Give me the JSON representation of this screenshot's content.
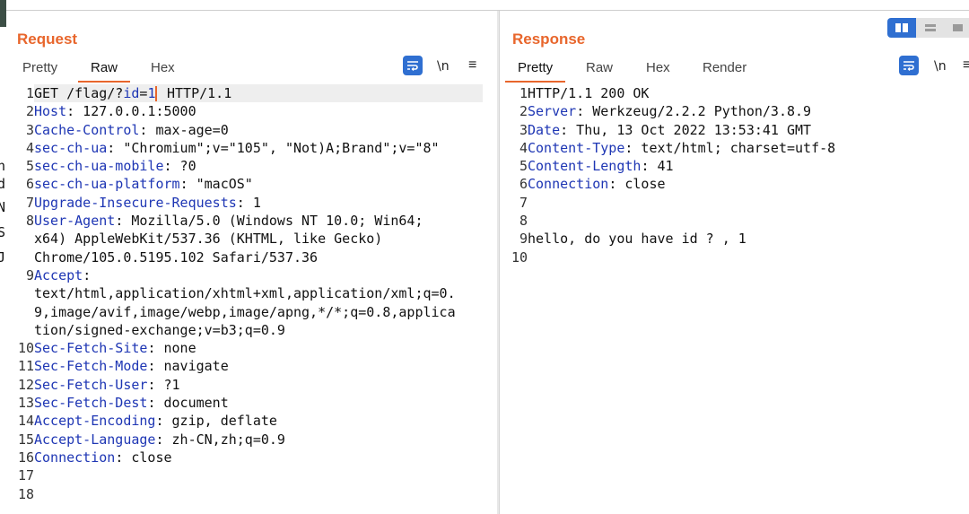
{
  "edge_letters": [
    "h",
    "d",
    "N",
    "S",
    "J"
  ],
  "request": {
    "title": "Request",
    "tabs": [
      "Pretty",
      "Raw",
      "Hex"
    ],
    "active_tab": "Raw",
    "tool_newline": "\\n",
    "tool_menu": "≡",
    "lines": [
      {
        "n": "1",
        "parts": [
          {
            "t": "GET /flag/?",
            "c": "v"
          },
          {
            "t": "id",
            "c": "k"
          },
          {
            "t": "=",
            "c": "v"
          },
          {
            "t": "1",
            "c": "k"
          },
          {
            "cursor": true
          },
          {
            "t": " HTTP/1.1",
            "c": "v"
          }
        ],
        "hl": true
      },
      {
        "n": "2",
        "parts": [
          {
            "t": "Host",
            "c": "k"
          },
          {
            "t": ": 127.0.0.1:5000",
            "c": "v"
          }
        ]
      },
      {
        "n": "3",
        "parts": [
          {
            "t": "Cache-Control",
            "c": "k"
          },
          {
            "t": ": max-age=0",
            "c": "v"
          }
        ]
      },
      {
        "n": "4",
        "parts": [
          {
            "t": "sec-ch-ua",
            "c": "k"
          },
          {
            "t": ": \"Chromium\";v=\"105\", \"Not)A;Brand\";v=\"8\"",
            "c": "v"
          }
        ]
      },
      {
        "n": "5",
        "parts": [
          {
            "t": "sec-ch-ua-mobile",
            "c": "k"
          },
          {
            "t": ": ?0",
            "c": "v"
          }
        ]
      },
      {
        "n": "6",
        "parts": [
          {
            "t": "sec-ch-ua-platform",
            "c": "k"
          },
          {
            "t": ": \"macOS\"",
            "c": "v"
          }
        ]
      },
      {
        "n": "7",
        "parts": [
          {
            "t": "Upgrade-Insecure-Requests",
            "c": "k"
          },
          {
            "t": ": 1",
            "c": "v"
          }
        ]
      },
      {
        "n": "8",
        "parts": [
          {
            "t": "User-Agent",
            "c": "k"
          },
          {
            "t": ": Mozilla/5.0 (Windows NT 10.0; Win64;",
            "c": "v"
          }
        ]
      },
      {
        "n": "",
        "parts": [
          {
            "t": "x64) AppleWebKit/537.36 (KHTML, like Gecko)",
            "c": "v"
          }
        ]
      },
      {
        "n": "",
        "parts": [
          {
            "t": "Chrome/105.0.5195.102 Safari/537.36",
            "c": "v"
          }
        ]
      },
      {
        "n": "9",
        "parts": [
          {
            "t": "Accept",
            "c": "k"
          },
          {
            "t": ":",
            "c": "v"
          }
        ]
      },
      {
        "n": "",
        "parts": [
          {
            "t": "text/html,application/xhtml+xml,application/xml;q=0.",
            "c": "v"
          }
        ]
      },
      {
        "n": "",
        "parts": [
          {
            "t": "9,image/avif,image/webp,image/apng,*/*;q=0.8,applica",
            "c": "v"
          }
        ]
      },
      {
        "n": "",
        "parts": [
          {
            "t": "tion/signed-exchange;v=b3;q=0.9",
            "c": "v"
          }
        ]
      },
      {
        "n": "10",
        "parts": [
          {
            "t": "Sec-Fetch-Site",
            "c": "k"
          },
          {
            "t": ": none",
            "c": "v"
          }
        ]
      },
      {
        "n": "11",
        "parts": [
          {
            "t": "Sec-Fetch-Mode",
            "c": "k"
          },
          {
            "t": ": navigate",
            "c": "v"
          }
        ]
      },
      {
        "n": "12",
        "parts": [
          {
            "t": "Sec-Fetch-User",
            "c": "k"
          },
          {
            "t": ": ?1",
            "c": "v"
          }
        ]
      },
      {
        "n": "13",
        "parts": [
          {
            "t": "Sec-Fetch-Dest",
            "c": "k"
          },
          {
            "t": ": document",
            "c": "v"
          }
        ]
      },
      {
        "n": "14",
        "parts": [
          {
            "t": "Accept-Encoding",
            "c": "k"
          },
          {
            "t": ": gzip, deflate",
            "c": "v"
          }
        ]
      },
      {
        "n": "15",
        "parts": [
          {
            "t": "Accept-Language",
            "c": "k"
          },
          {
            "t": ": zh-CN,zh;q=0.9",
            "c": "v"
          }
        ]
      },
      {
        "n": "16",
        "parts": [
          {
            "t": "Connection",
            "c": "k"
          },
          {
            "t": ": close",
            "c": "v"
          }
        ]
      },
      {
        "n": "17",
        "parts": []
      },
      {
        "n": "18",
        "parts": []
      }
    ]
  },
  "response": {
    "title": "Response",
    "tabs": [
      "Pretty",
      "Raw",
      "Hex",
      "Render"
    ],
    "active_tab": "Pretty",
    "tool_newline": "\\n",
    "tool_menu": "≡",
    "lines": [
      {
        "n": "1",
        "parts": [
          {
            "t": "HTTP/1.1 200 OK",
            "c": "v"
          }
        ]
      },
      {
        "n": "2",
        "parts": [
          {
            "t": "Server",
            "c": "k"
          },
          {
            "t": ": Werkzeug/2.2.2 Python/3.8.9",
            "c": "v"
          }
        ]
      },
      {
        "n": "3",
        "parts": [
          {
            "t": "Date",
            "c": "k"
          },
          {
            "t": ": Thu, 13 Oct 2022 13:53:41 GMT",
            "c": "v"
          }
        ]
      },
      {
        "n": "4",
        "parts": [
          {
            "t": "Content-Type",
            "c": "k"
          },
          {
            "t": ": text/html; charset=utf-8",
            "c": "v"
          }
        ]
      },
      {
        "n": "5",
        "parts": [
          {
            "t": "Content-Length",
            "c": "k"
          },
          {
            "t": ": 41",
            "c": "v"
          }
        ]
      },
      {
        "n": "6",
        "parts": [
          {
            "t": "Connection",
            "c": "k"
          },
          {
            "t": ": close",
            "c": "v"
          }
        ]
      },
      {
        "n": "7",
        "parts": []
      },
      {
        "n": "8",
        "parts": []
      },
      {
        "n": "9",
        "parts": [
          {
            "t": "hello, do you have id ? , 1",
            "c": "v"
          }
        ]
      },
      {
        "n": "10",
        "parts": []
      }
    ]
  },
  "colors": {
    "accent": "#e8662c",
    "header_key": "#1e36b4",
    "tool_blue": "#2f6fd1"
  }
}
